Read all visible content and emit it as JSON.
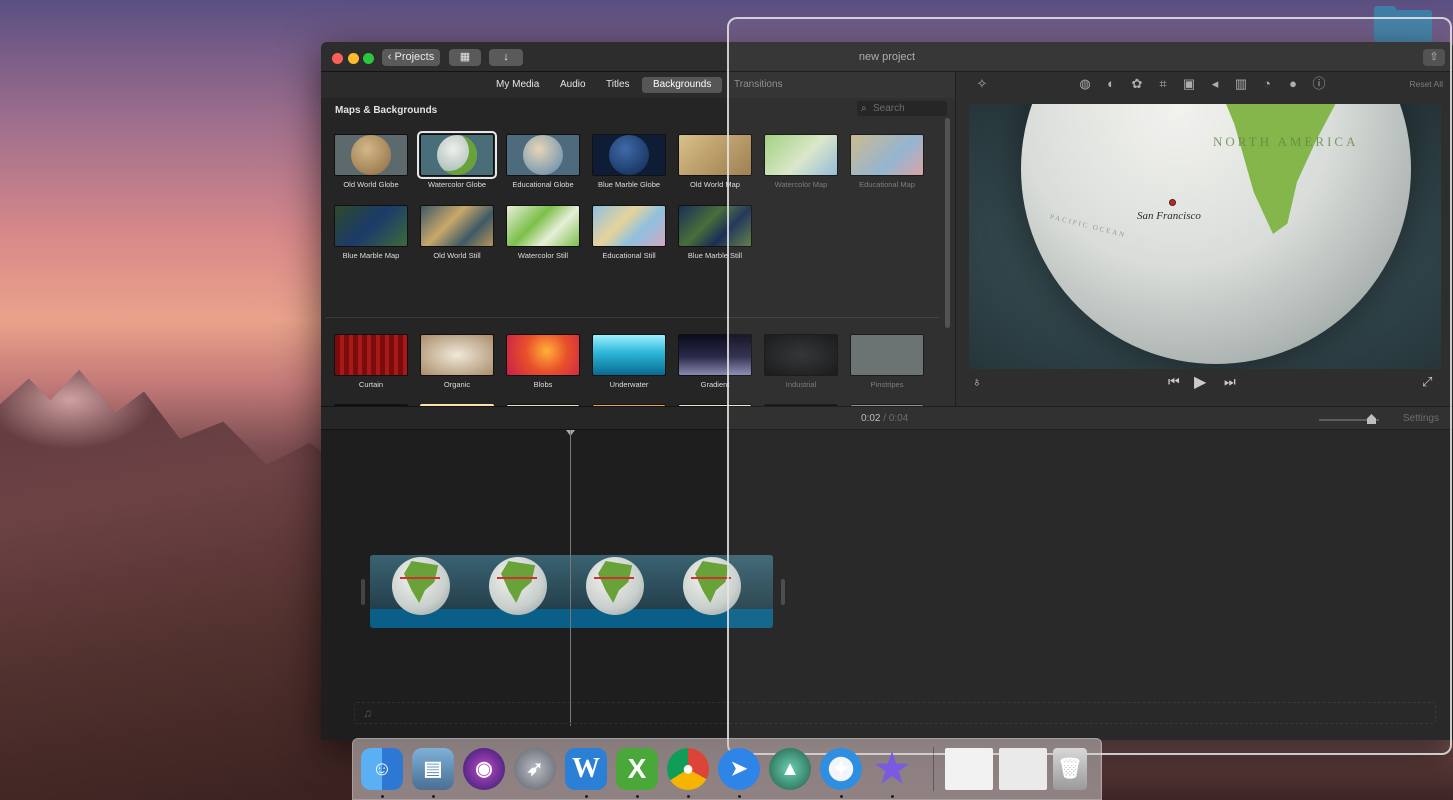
{
  "window": {
    "title": "new project",
    "projects_label": "Projects"
  },
  "tabs": [
    {
      "label": "My Media"
    },
    {
      "label": "Audio"
    },
    {
      "label": "Titles"
    },
    {
      "label": "Backgrounds",
      "active": true
    },
    {
      "label": "Transitions"
    }
  ],
  "browser": {
    "section_title": "Maps & Backgrounds",
    "search_placeholder": "Search",
    "maps": [
      {
        "label": "Old World Globe"
      },
      {
        "label": "Watercolor Globe",
        "selected": true
      },
      {
        "label": "Educational Globe"
      },
      {
        "label": "Blue Marble Globe"
      },
      {
        "label": "Old World Map"
      },
      {
        "label": "Watercolor Map"
      },
      {
        "label": "Educational Map"
      },
      {
        "label": "Blue Marble Map"
      },
      {
        "label": "Old World Still"
      },
      {
        "label": "Watercolor Still"
      },
      {
        "label": "Educational Still"
      },
      {
        "label": "Blue Marble Still"
      }
    ],
    "backgrounds": [
      {
        "label": "Curtain"
      },
      {
        "label": "Organic"
      },
      {
        "label": "Blobs"
      },
      {
        "label": "Underwater"
      },
      {
        "label": "Gradient"
      },
      {
        "label": "Industrial"
      },
      {
        "label": "Pinstripes"
      }
    ]
  },
  "viewer": {
    "reset_label": "Reset All",
    "map_label": "NORTH AMERICA",
    "city_label": "San Francisco",
    "ocean_label": "PACIFIC OCEAN"
  },
  "timeline": {
    "current_time": "0:02",
    "separator": "/",
    "total_time": "0:04",
    "settings_label": "Settings"
  },
  "dock": {
    "apps": [
      {
        "icon": "finder-icon",
        "color": "#3a8fe0"
      },
      {
        "icon": "preview-icon",
        "color": "#6e8fb0"
      },
      {
        "icon": "siri-icon",
        "color": "#5a3fb0"
      },
      {
        "icon": "launchpad-icon",
        "color": "#7a7f88"
      },
      {
        "icon": "word-icon",
        "color": "#2b7fd4",
        "text": "W"
      },
      {
        "icon": "excel-icon",
        "color": "#4aa83a",
        "text": "X"
      },
      {
        "icon": "chrome-icon",
        "color": "#dd4433"
      },
      {
        "icon": "spark-icon",
        "color": "#2f84e8"
      },
      {
        "icon": "macos-installer-icon",
        "color": "#3f8f6e"
      },
      {
        "icon": "safari-icon",
        "color": "#2f8ee0"
      },
      {
        "icon": "imovie-icon",
        "color": "#6a4fd0"
      }
    ]
  }
}
